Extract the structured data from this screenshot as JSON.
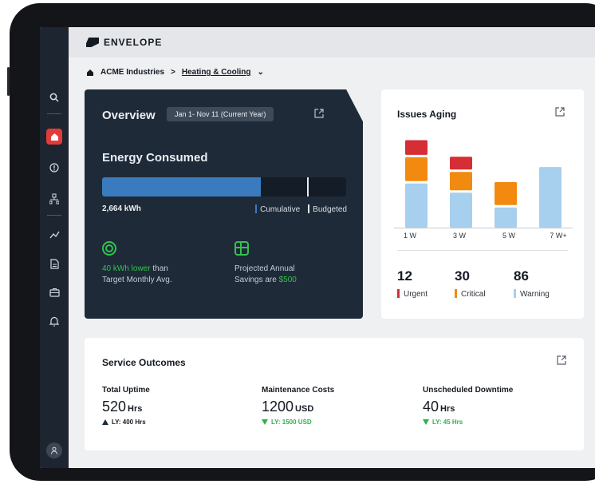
{
  "app": {
    "brand": "ENVELOPE"
  },
  "breadcrumb": {
    "org": "ACME Industries",
    "separator": ">",
    "current": "Heating & Cooling",
    "dropdown": "⌄"
  },
  "sidebar": {
    "icons": [
      "search-icon",
      "home-icon",
      "alert-icon",
      "network-icon",
      "trend-icon",
      "document-icon",
      "briefcase-icon",
      "bell-icon",
      "user-icon"
    ]
  },
  "overview": {
    "title": "Overview",
    "date_range": "Jan 1- Nov 11 (Current Year)",
    "energy_title": "Energy Consumed",
    "energy_value": "2,664 kWh",
    "cumulative_fraction": 0.65,
    "budget_fraction": 0.84,
    "legend_cumulative": "Cumulative",
    "legend_budgeted": "Budgeted",
    "stat1_highlight": "40 kWh lower",
    "stat1_rest": " than",
    "stat1_line2": "Target Monthly Avg.",
    "stat2_line1": "Projected Annual",
    "stat2_prefix": "Savings are ",
    "stat2_highlight": "$500"
  },
  "issues": {
    "title": "Issues Aging",
    "expand_icon": "⤢",
    "urgent_count": "12",
    "critical_count": "30",
    "warning_count": "86",
    "urgent_label": "Urgent",
    "critical_label": "Critical",
    "warning_label": "Warning",
    "colors": {
      "urgent": "#d62e35",
      "critical": "#f28a10",
      "warning": "#a7cfee"
    }
  },
  "chart_data": {
    "type": "bar",
    "categories": [
      "1 W",
      "3 W",
      "5 W",
      "7 W+"
    ],
    "series": [
      {
        "name": "Warning",
        "values": [
          48,
          38,
          22,
          66
        ]
      },
      {
        "name": "Critical",
        "values": [
          26,
          20,
          25,
          0
        ]
      },
      {
        "name": "Urgent",
        "values": [
          16,
          14,
          0,
          0
        ]
      }
    ],
    "ylim": [
      0,
      100
    ]
  },
  "service": {
    "title": "Service Outcomes",
    "metrics": [
      {
        "label": "Total Uptime",
        "value": "520",
        "unit": "Hrs",
        "ly": "LY: 400 Hrs",
        "trend": "up"
      },
      {
        "label": "Maintenance Costs",
        "value": "1200",
        "unit": "USD",
        "ly": "LY: 1500 USD",
        "trend": "down"
      },
      {
        "label": "Unscheduled Downtime",
        "value": "40",
        "unit": "Hrs",
        "ly": "LY: 45 Hrs",
        "trend": "down"
      }
    ]
  }
}
